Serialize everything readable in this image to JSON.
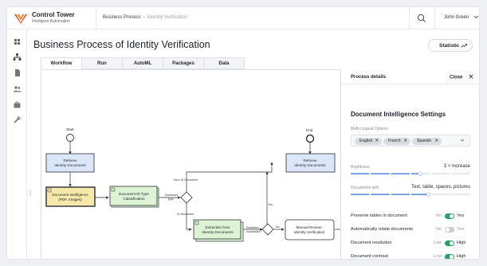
{
  "app": {
    "name": "Control Tower",
    "subtitle": "Intelligent Automation"
  },
  "breadcrumb": {
    "parent": "Business Process",
    "separator": "›",
    "current": "Identity Verification"
  },
  "user": {
    "name": "John Green",
    "menu_icon": "chevron-down-icon"
  },
  "sidebar": {
    "items": [
      "dashboard-icon",
      "process-icon",
      "document-icon",
      "users-icon",
      "briefcase-icon",
      "wrench-icon"
    ]
  },
  "page": {
    "title": "Business Process of Identity Verification"
  },
  "statistic_button": {
    "label": "Statistic",
    "icon": "trend-icon"
  },
  "tabs": [
    {
      "label": "Workflow",
      "active": true
    },
    {
      "label": "Run",
      "active": false
    },
    {
      "label": "AutoML",
      "active": false
    },
    {
      "label": "Packages",
      "active": false
    },
    {
      "label": "Data",
      "active": false
    }
  ],
  "workflow": {
    "events": {
      "start": "Start",
      "end": "End"
    },
    "nodes": {
      "retrieve_left": [
        "Retrieve",
        "Identity Documents"
      ],
      "doc_intel": [
        "Document Intelligence",
        "(PDF, Images)"
      ],
      "classify": [
        "Document ID Type",
        "Classification"
      ],
      "extract": [
        "Extraction from",
        "Identity Documents"
      ],
      "manual": [
        "Manual Review:",
        "Identity Verification"
      ],
      "retrieve_right": [
        "Retrieve",
        "Identity Documents"
      ]
    },
    "edges": {
      "doc_type": [
        "Document",
        "type"
      ],
      "non_id": "Non- ID Document",
      "id_doc": "ID Document",
      "extraction_success": [
        "Extraction",
        "successful?"
      ],
      "no": "No",
      "yes": "Yes"
    },
    "colors": {
      "blue_node": "#dce6fb",
      "yellow_node": "#f6e9a9",
      "green_node": "#ddf3d3",
      "border": "#2b2f36"
    }
  },
  "panel": {
    "title": "Process details",
    "close_label": "Close",
    "section_title": "Document Intelligence Settings",
    "multilingual": {
      "label": "Multi-Lingual Options",
      "chips": [
        "English",
        "French",
        "Spanish"
      ]
    },
    "brightness": {
      "label": "Brightness",
      "value": "3 × Increase",
      "level": 0.58
    },
    "documents_with": {
      "label": "Documents with",
      "value": "Text, table, spaces, pictures",
      "level": 0.65
    },
    "toggles": [
      {
        "label": "Preserve tables in document",
        "off": "No",
        "on": "Yes",
        "state": true
      },
      {
        "label": "Automatically rotate documents",
        "off": "No",
        "on": "Yes",
        "state": false
      },
      {
        "label": "Document resolution",
        "off": "Low",
        "on": "High",
        "state": true
      },
      {
        "label": "Document contrast",
        "off": "Low",
        "on": "High",
        "state": true
      }
    ],
    "accent_color": "#2b6cd6",
    "toggle_on_color": "#26a269"
  }
}
